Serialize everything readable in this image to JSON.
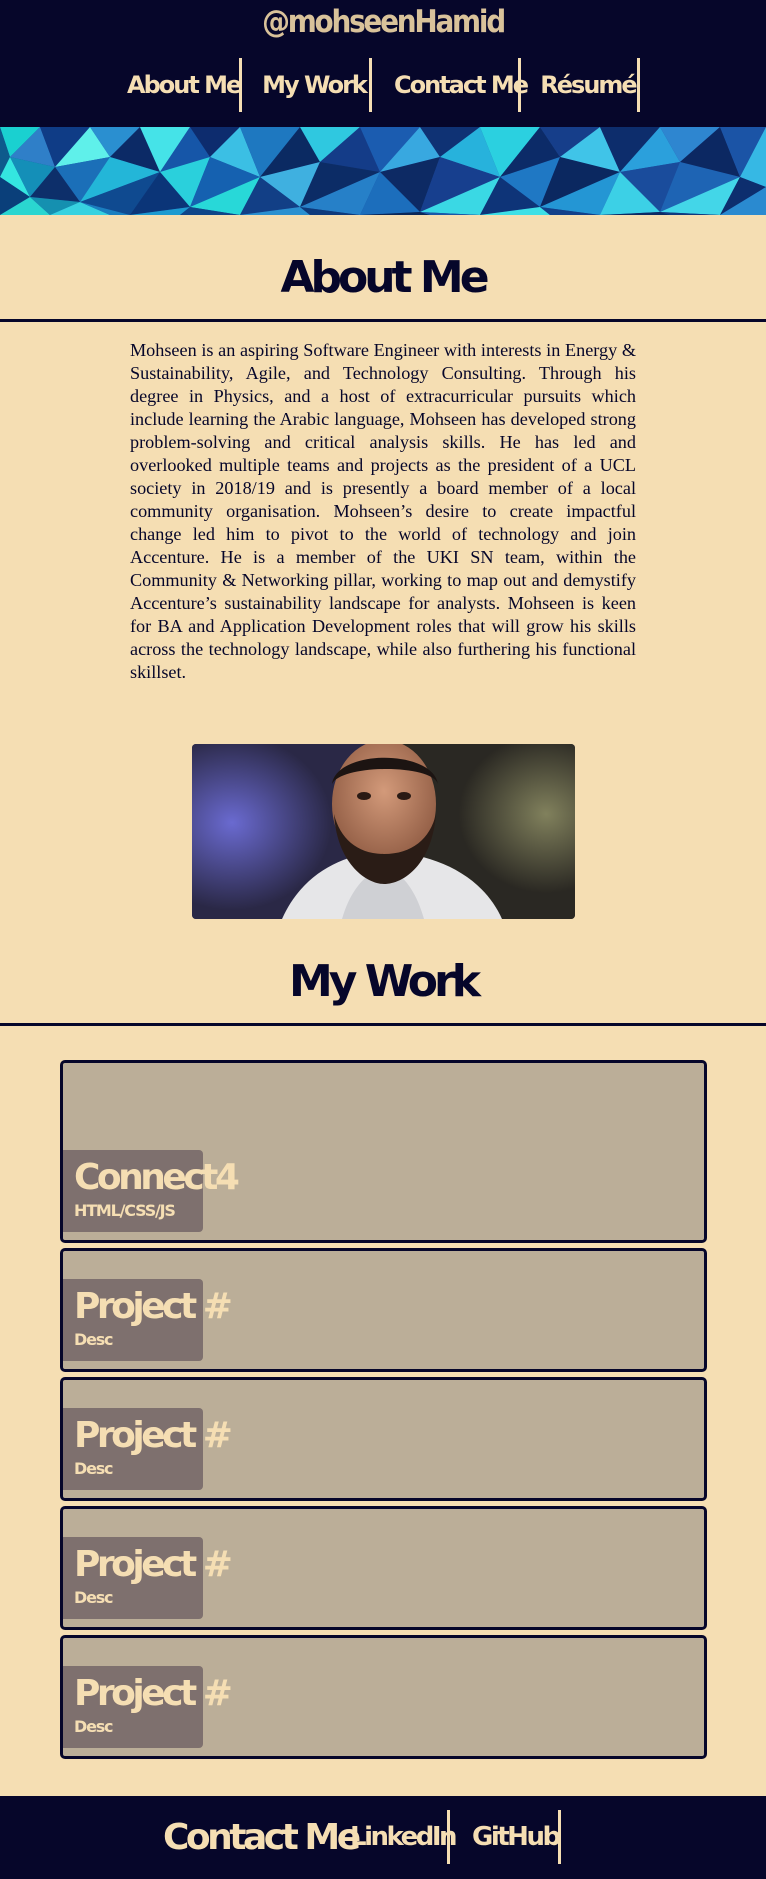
{
  "header": {
    "site_title": "@mohseenHamid",
    "nav": [
      {
        "label": "About Me"
      },
      {
        "label": "My Work"
      },
      {
        "label": "Contact Me"
      },
      {
        "label": "Résumé"
      }
    ]
  },
  "about": {
    "title": "About Me",
    "body": "Mohseen is an aspiring Software Engineer with interests in Energy & Sustainability, Agile, and Technology Consulting. Through his degree in Physics, and a host of extracurricular pursuits which include learning the Arabic language, Mohseen has developed strong problem-solving and critical analysis skills. He has led and overlooked multiple teams and projects as the president of a UCL society in 2018/19 and is presently a board member of a local community organisation. Mohseen’s desire to create impactful change led him to pivot to the world of technology and join Accenture. He is a member of the UKI SN team, within the Community & Networking pillar, working to map out and demystify Accenture’s sustainability landscape for analysts. Mohseen is keen for BA and Application Development roles that will grow his skills across the technology landscape, while also furthering his functional skillset."
  },
  "work": {
    "title": "My Work",
    "projects": [
      {
        "title": "Connect4",
        "desc": "HTML/CSS/JS"
      },
      {
        "title": "Project #",
        "desc": "Desc"
      },
      {
        "title": "Project #",
        "desc": "Desc"
      },
      {
        "title": "Project #",
        "desc": "Desc"
      },
      {
        "title": "Project #",
        "desc": "Desc"
      }
    ]
  },
  "footer": {
    "title": "Contact Me",
    "links": [
      {
        "label": "LinkedIn"
      },
      {
        "label": "GitHub"
      }
    ]
  },
  "colors": {
    "navy": "#06062a",
    "wheat": "#f5deb3",
    "card": "#bbae98",
    "card_label": "#7e706e"
  }
}
